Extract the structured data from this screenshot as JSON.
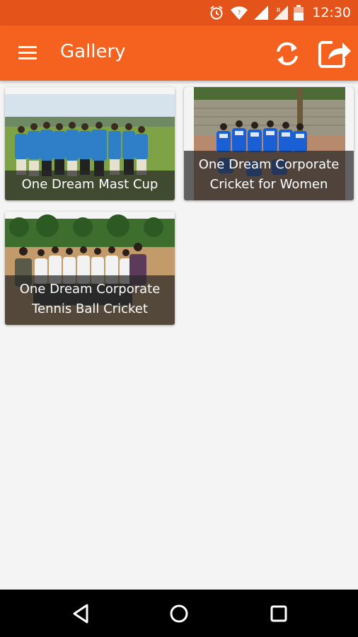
{
  "status_bar": {
    "time": "12:30",
    "icons": [
      "alarm-icon",
      "wifi-icon",
      "signal-icon",
      "signal-roaming-icon",
      "battery-charging-icon"
    ],
    "background": "#e4531a"
  },
  "app_bar": {
    "title": "Gallery",
    "background": "#f5611e",
    "icons": [
      "menu-icon",
      "refresh-icon",
      "share-icon"
    ]
  },
  "gallery": {
    "items": [
      {
        "caption": "One Dream Mast Cup"
      },
      {
        "caption": "One Dream Corporate Cricket for Women"
      },
      {
        "caption": "One Dream Corporate Tennis Ball Cricket"
      }
    ]
  },
  "nav_bar": {
    "icons": [
      "back-icon",
      "home-icon",
      "recents-icon"
    ],
    "background": "#000000"
  }
}
